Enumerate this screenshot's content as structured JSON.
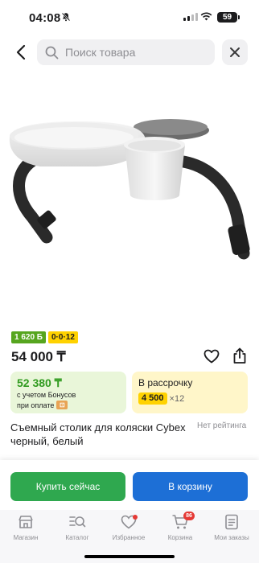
{
  "status": {
    "time": "04:08",
    "battery": "59",
    "bell_muted_icon": "bell-slash-icon"
  },
  "search": {
    "placeholder": "Поиск товара"
  },
  "badges": {
    "bonus": "1 620 Б",
    "installment": "0·0·12"
  },
  "product": {
    "price": "54 000 ₸",
    "title": "Съемный столик для коляски Cybex черный, белый",
    "rating_text": "Нет рейтинга"
  },
  "bonus_card": {
    "amount": "52 380 ₸",
    "line1": "с учетом Бонусов",
    "line2": "при оплате"
  },
  "installment_card": {
    "label": "В рассрочку",
    "monthly": "4 500",
    "term": "×12"
  },
  "actions": {
    "buy_now": "Купить сейчас",
    "add_to_cart": "В корзину"
  },
  "tabbar": {
    "items": [
      {
        "label": "Магазин"
      },
      {
        "label": "Каталог"
      },
      {
        "label": "Избранное"
      },
      {
        "label": "Корзина",
        "badge": "86"
      },
      {
        "label": "Мои заказы"
      }
    ]
  },
  "colors": {
    "green_button": "#2fa84f",
    "blue_button": "#1d6fd6",
    "bonus_badge": "#56a51f",
    "installment_badge": "#ffd200",
    "badge_red": "#e53935"
  }
}
